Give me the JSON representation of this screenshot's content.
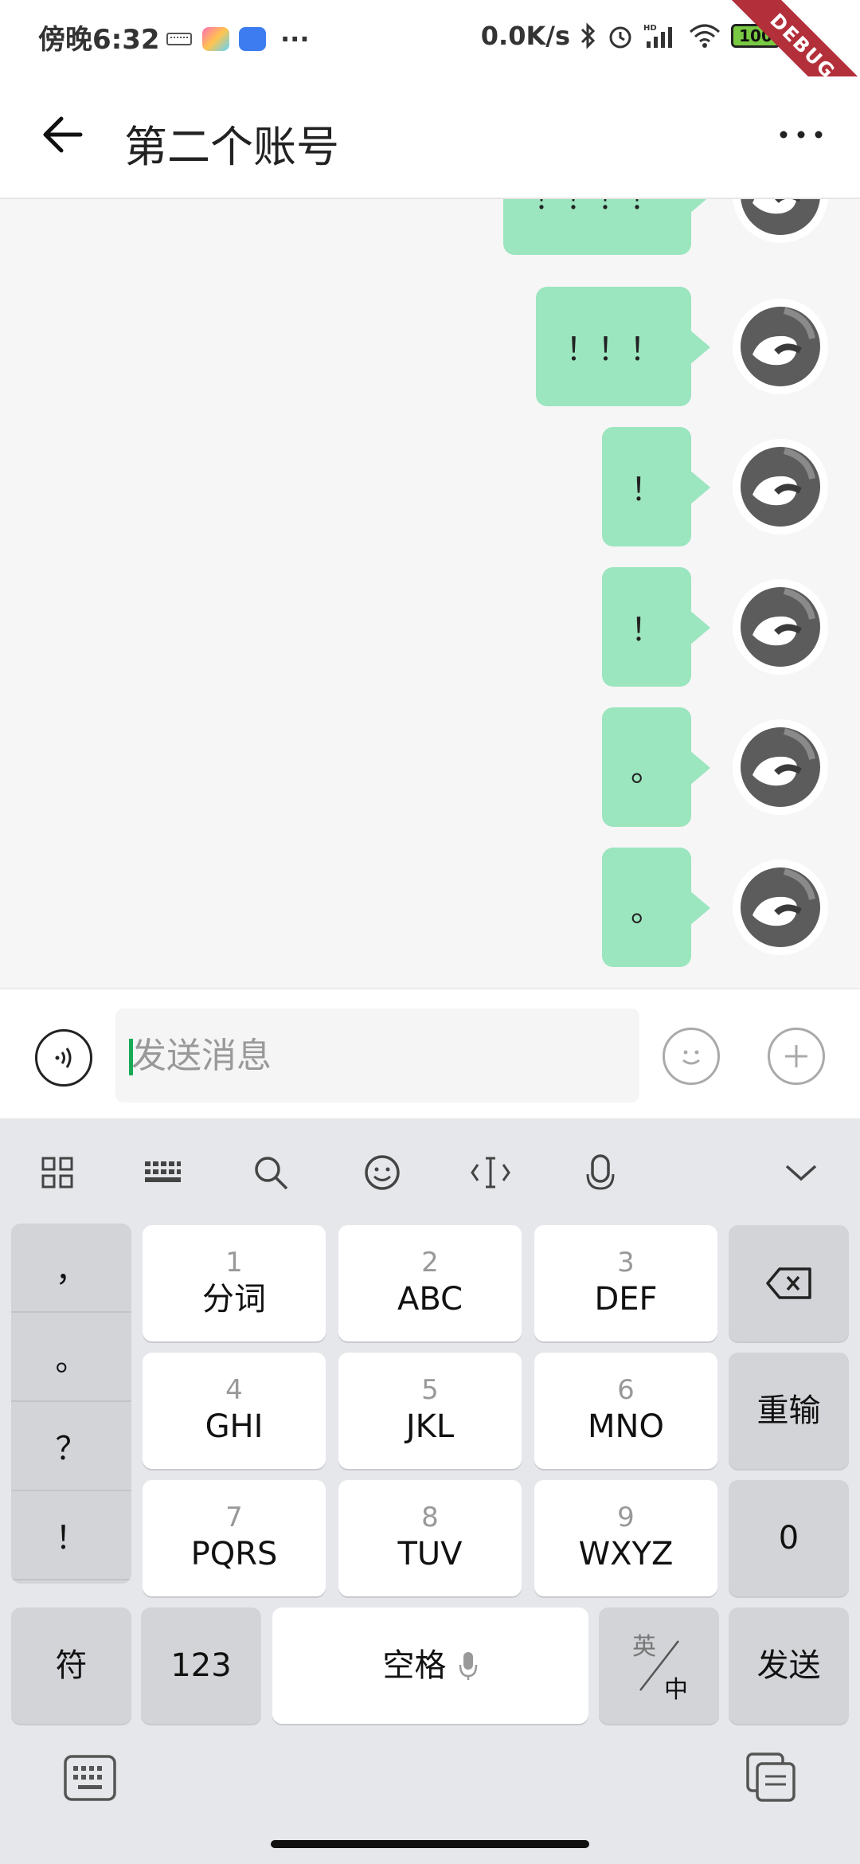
{
  "status_bar": {
    "time": "傍晚6:32",
    "overflow": "···",
    "speed": "0.0K/s",
    "battery": "100",
    "debug_banner": "DEBUG"
  },
  "app_bar": {
    "title": "第二个账号",
    "back_icon": "arrow-left-icon",
    "more_icon": "more-horizontal-icon"
  },
  "messages": [
    {
      "text": "！！！！"
    },
    {
      "text": "！！！"
    },
    {
      "text": "！"
    },
    {
      "text": "！"
    },
    {
      "text": "。"
    },
    {
      "text": "。"
    }
  ],
  "input_bar": {
    "placeholder": "发送消息",
    "value": ""
  },
  "keyboard": {
    "toolbar": [
      "grid-icon",
      "keyboard-grid-icon",
      "search-icon",
      "smile-icon",
      "cursor-icon",
      "mic-icon",
      "chevron-down-icon"
    ],
    "punctuation": [
      "，",
      "。",
      "？",
      "！"
    ],
    "keys": [
      {
        "num": "1",
        "label": "分词"
      },
      {
        "num": "2",
        "label": "ABC"
      },
      {
        "num": "3",
        "label": "DEF"
      },
      {
        "num": "4",
        "label": "GHI"
      },
      {
        "num": "5",
        "label": "JKL"
      },
      {
        "num": "6",
        "label": "MNO"
      },
      {
        "num": "7",
        "label": "PQRS"
      },
      {
        "num": "8",
        "label": "TUV"
      },
      {
        "num": "9",
        "label": "WXYZ"
      }
    ],
    "retype": "重输",
    "zero": "0",
    "symbols": "符",
    "numbers": "123",
    "space": "空格",
    "lang_en": "英",
    "lang_zh": "中",
    "send": "发送"
  },
  "colors": {
    "bubble": "#9be5bf",
    "accent": "#1aaa55"
  }
}
